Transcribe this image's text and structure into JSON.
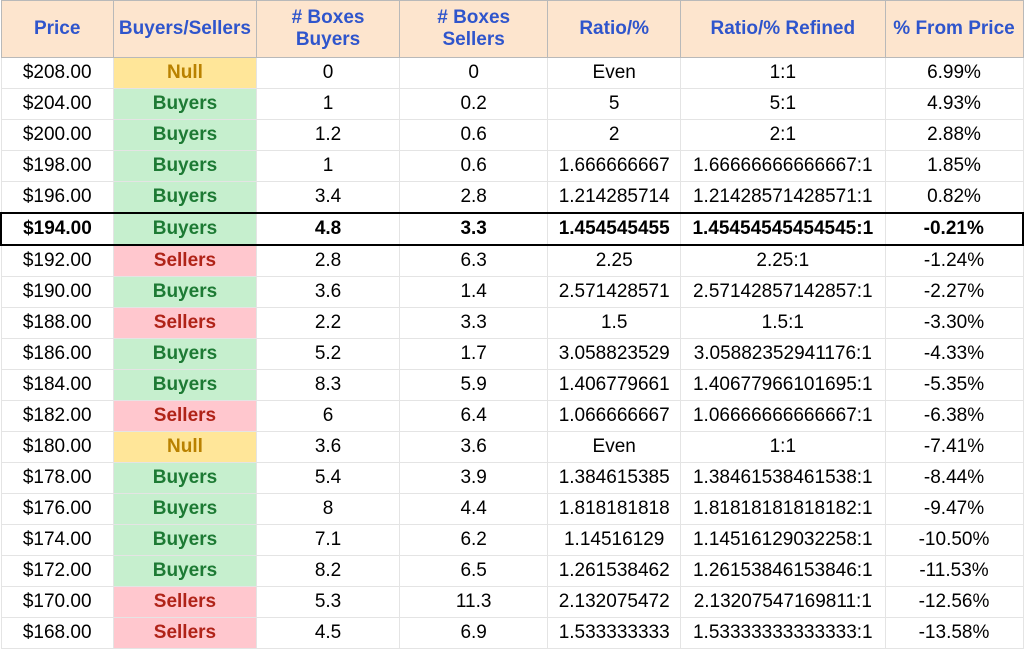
{
  "columns": {
    "price": "Price",
    "bs": "Buyers/Sellers",
    "bb": "# Boxes Buyers",
    "sb": "# Boxes Sellers",
    "ratio": "Ratio/%",
    "refined": "Ratio/% Refined",
    "pct": "% From Price"
  },
  "bs_labels": {
    "null": "Null",
    "buy": "Buyers",
    "sell": "Sellers"
  },
  "rows": [
    {
      "price": "$208.00",
      "bs": "null",
      "bb": "0",
      "sb": "0",
      "ratio": "Even",
      "refined": "1:1",
      "pct": "6.99%",
      "bold": false
    },
    {
      "price": "$204.00",
      "bs": "buy",
      "bb": "1",
      "sb": "0.2",
      "ratio": "5",
      "refined": "5:1",
      "pct": "4.93%",
      "bold": false
    },
    {
      "price": "$200.00",
      "bs": "buy",
      "bb": "1.2",
      "sb": "0.6",
      "ratio": "2",
      "refined": "2:1",
      "pct": "2.88%",
      "bold": false
    },
    {
      "price": "$198.00",
      "bs": "buy",
      "bb": "1",
      "sb": "0.6",
      "ratio": "1.666666667",
      "refined": "1.66666666666667:1",
      "pct": "1.85%",
      "bold": false
    },
    {
      "price": "$196.00",
      "bs": "buy",
      "bb": "3.4",
      "sb": "2.8",
      "ratio": "1.214285714",
      "refined": "1.21428571428571:1",
      "pct": "0.82%",
      "bold": false
    },
    {
      "price": "$194.00",
      "bs": "buy",
      "bb": "4.8",
      "sb": "3.3",
      "ratio": "1.454545455",
      "refined": "1.45454545454545:1",
      "pct": "-0.21%",
      "bold": true
    },
    {
      "price": "$192.00",
      "bs": "sell",
      "bb": "2.8",
      "sb": "6.3",
      "ratio": "2.25",
      "refined": "2.25:1",
      "pct": "-1.24%",
      "bold": false
    },
    {
      "price": "$190.00",
      "bs": "buy",
      "bb": "3.6",
      "sb": "1.4",
      "ratio": "2.571428571",
      "refined": "2.57142857142857:1",
      "pct": "-2.27%",
      "bold": false
    },
    {
      "price": "$188.00",
      "bs": "sell",
      "bb": "2.2",
      "sb": "3.3",
      "ratio": "1.5",
      "refined": "1.5:1",
      "pct": "-3.30%",
      "bold": false
    },
    {
      "price": "$186.00",
      "bs": "buy",
      "bb": "5.2",
      "sb": "1.7",
      "ratio": "3.058823529",
      "refined": "3.05882352941176:1",
      "pct": "-4.33%",
      "bold": false
    },
    {
      "price": "$184.00",
      "bs": "buy",
      "bb": "8.3",
      "sb": "5.9",
      "ratio": "1.406779661",
      "refined": "1.40677966101695:1",
      "pct": "-5.35%",
      "bold": false
    },
    {
      "price": "$182.00",
      "bs": "sell",
      "bb": "6",
      "sb": "6.4",
      "ratio": "1.066666667",
      "refined": "1.06666666666667:1",
      "pct": "-6.38%",
      "bold": false
    },
    {
      "price": "$180.00",
      "bs": "null",
      "bb": "3.6",
      "sb": "3.6",
      "ratio": "Even",
      "refined": "1:1",
      "pct": "-7.41%",
      "bold": false
    },
    {
      "price": "$178.00",
      "bs": "buy",
      "bb": "5.4",
      "sb": "3.9",
      "ratio": "1.384615385",
      "refined": "1.38461538461538:1",
      "pct": "-8.44%",
      "bold": false
    },
    {
      "price": "$176.00",
      "bs": "buy",
      "bb": "8",
      "sb": "4.4",
      "ratio": "1.818181818",
      "refined": "1.81818181818182:1",
      "pct": "-9.47%",
      "bold": false
    },
    {
      "price": "$174.00",
      "bs": "buy",
      "bb": "7.1",
      "sb": "6.2",
      "ratio": "1.14516129",
      "refined": "1.14516129032258:1",
      "pct": "-10.50%",
      "bold": false
    },
    {
      "price": "$172.00",
      "bs": "buy",
      "bb": "8.2",
      "sb": "6.5",
      "ratio": "1.261538462",
      "refined": "1.26153846153846:1",
      "pct": "-11.53%",
      "bold": false
    },
    {
      "price": "$170.00",
      "bs": "sell",
      "bb": "5.3",
      "sb": "11.3",
      "ratio": "2.132075472",
      "refined": "2.13207547169811:1",
      "pct": "-12.56%",
      "bold": false
    },
    {
      "price": "$168.00",
      "bs": "sell",
      "bb": "4.5",
      "sb": "6.9",
      "ratio": "1.533333333",
      "refined": "1.53333333333333:1",
      "pct": "-13.58%",
      "bold": false
    }
  ]
}
